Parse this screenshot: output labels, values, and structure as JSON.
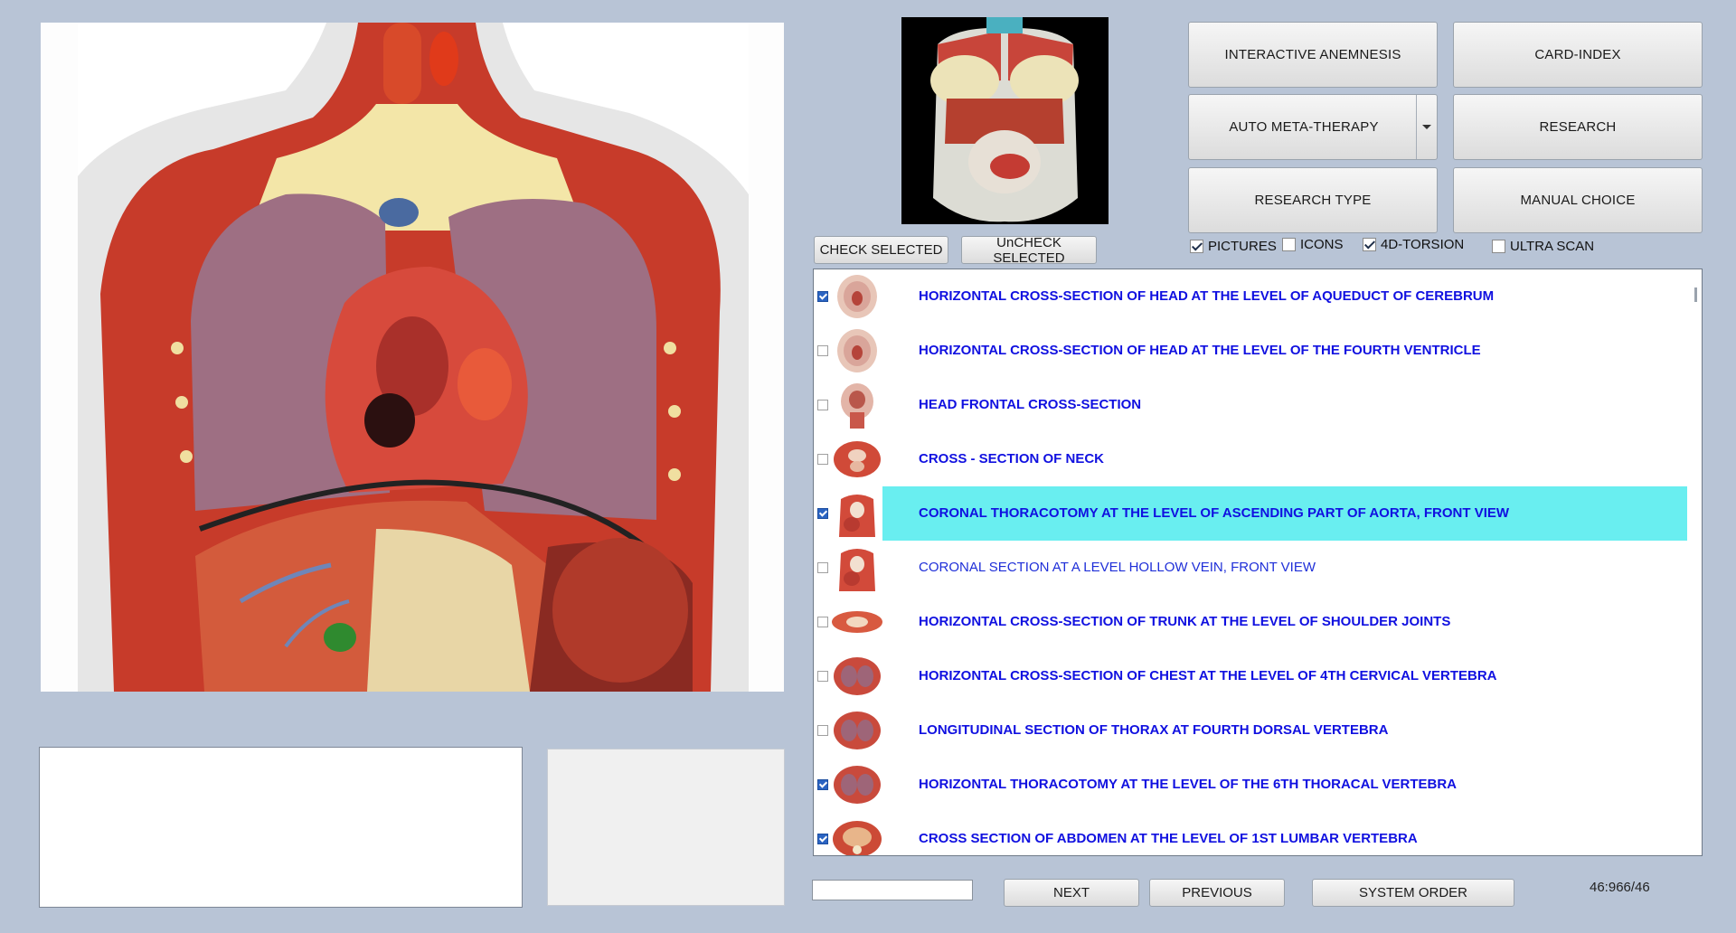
{
  "toolbar": {
    "interactive_anemnesis": "INTERACTIVE ANEMNESIS",
    "card_index": "CARD-INDEX",
    "auto_meta_therapy": "AUTO META-THERAPY",
    "research": "RESEARCH",
    "research_type": "RESEARCH TYPE",
    "manual_choice": "MANUAL CHOICE"
  },
  "selection": {
    "check_selected": "CHECK SELECTED",
    "uncheck_selected": "UnCHECK SELECTED"
  },
  "options": [
    {
      "label": "PICTURES",
      "checked": true
    },
    {
      "label": "ICONS",
      "checked": false
    },
    {
      "label": "4D-TORSION",
      "checked": true
    },
    {
      "label": "ULTRA SCAN",
      "checked": false
    }
  ],
  "list": [
    {
      "label": "HORIZONTAL CROSS-SECTION OF HEAD AT THE LEVEL OF AQUEDUCT OF CEREBRUM",
      "checked": true,
      "thumb": "head-axial"
    },
    {
      "label": "HORIZONTAL CROSS-SECTION OF HEAD AT THE LEVEL OF THE FOURTH VENTRICLE",
      "checked": false,
      "thumb": "head-axial"
    },
    {
      "label": "HEAD FRONTAL CROSS-SECTION",
      "checked": false,
      "thumb": "head-frontal"
    },
    {
      "label": "CROSS - SECTION  OF   NECK",
      "checked": false,
      "thumb": "neck"
    },
    {
      "label": "CORONAL THORACOTOMY AT THE LEVEL OF ASCENDING PART OF AORTA, FRONT VIEW",
      "checked": true,
      "thumb": "torso",
      "highlighted": true
    },
    {
      "label": "CORONAL SECTION AT A LEVEL HOLLOW VEIN, FRONT VIEW",
      "checked": false,
      "thumb": "torso",
      "normal": true
    },
    {
      "label": "HORIZONTAL CROSS-SECTION OF TRUNK AT THE LEVEL OF SHOULDER JOINTS",
      "checked": false,
      "thumb": "wide"
    },
    {
      "label": "HORIZONTAL CROSS-SECTION OF CHEST AT THE LEVEL OF 4TH CERVICAL VERTEBRA",
      "checked": false,
      "thumb": "chest"
    },
    {
      "label": "LONGITUDINAL SECTION OF THORAX AT FOURTH DORSAL VERTEBRA",
      "checked": false,
      "thumb": "chest"
    },
    {
      "label": "HORIZONTAL THORACOTOMY AT THE LEVEL OF THE 6TH THORACAL VERTEBRA",
      "checked": true,
      "thumb": "chest"
    },
    {
      "label": "CROSS SECTION OF ABDOMEN AT THE LEVEL OF 1ST LUMBAR VERTEBRA",
      "checked": true,
      "thumb": "abdomen"
    }
  ],
  "nav": {
    "next": "NEXT",
    "previous": "PREVIOUS",
    "system_order": "SYSTEM ORDER",
    "counter": "46:966/46",
    "search_value": ""
  },
  "colors": {
    "background": "#b8c4d6",
    "highlight": "#69eef0",
    "list_text": "#1010e0"
  }
}
